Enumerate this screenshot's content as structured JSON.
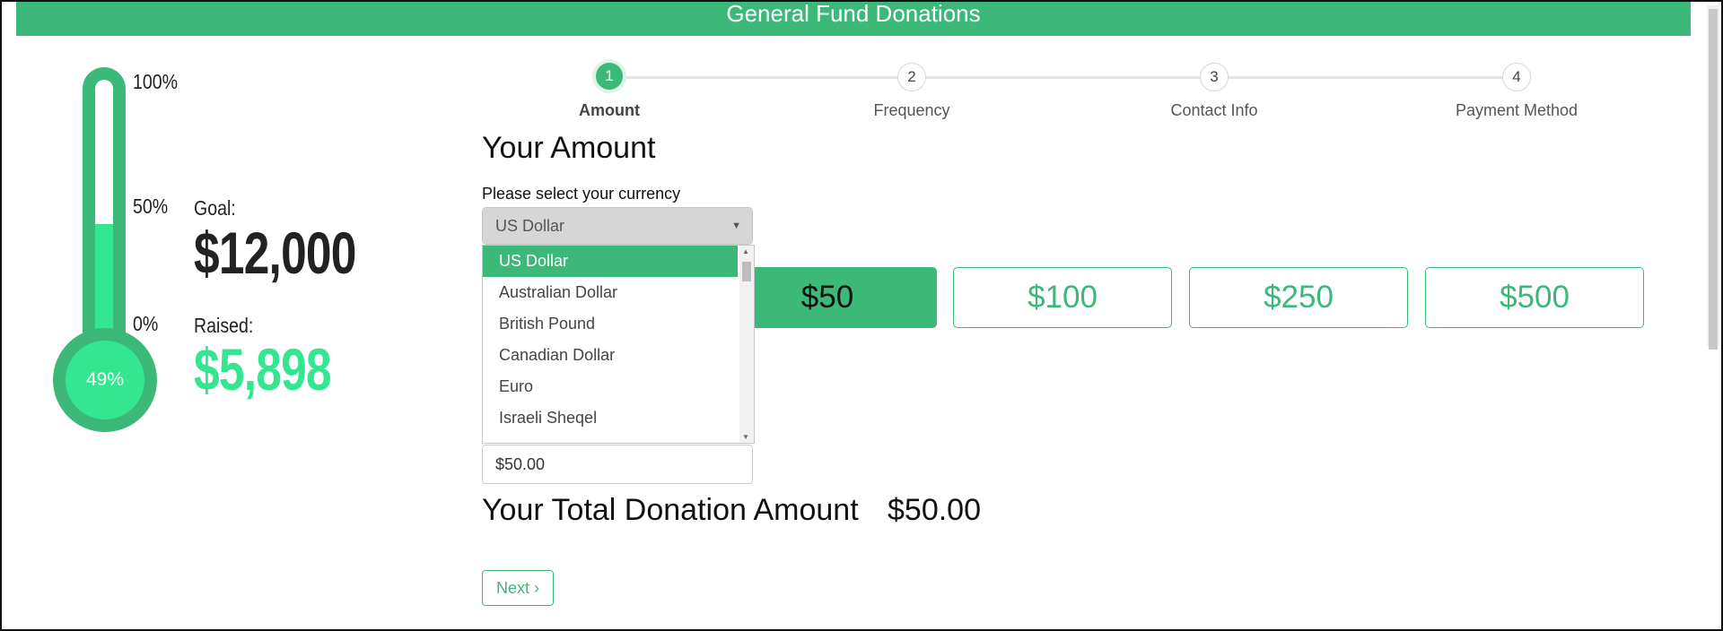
{
  "banner": {
    "title": "General Fund Donations"
  },
  "thermometer": {
    "percent_label": "49%",
    "fill_fraction": 0.49,
    "ticks": {
      "top": "100%",
      "mid": "50%",
      "bottom": "0%"
    },
    "colors": {
      "tube": "#3cb878",
      "fill": "#33e690"
    }
  },
  "stats": {
    "goal_label": "Goal:",
    "goal_value": "$12,000",
    "raised_label": "Raised:",
    "raised_value": "$5,898",
    "raised_color": "#33e690"
  },
  "steps": [
    {
      "number": "1",
      "label": "Amount",
      "active": true
    },
    {
      "number": "2",
      "label": "Frequency",
      "active": false
    },
    {
      "number": "3",
      "label": "Contact Info",
      "active": false
    },
    {
      "number": "4",
      "label": "Payment Method",
      "active": false
    }
  ],
  "form": {
    "title": "Your Amount",
    "currency_label": "Please select your currency",
    "currency_selected": "US Dollar",
    "currency_options": [
      "US Dollar",
      "Australian Dollar",
      "British Pound",
      "Canadian Dollar",
      "Euro",
      "Israeli Sheqel"
    ],
    "amount_buttons": [
      "$50",
      "$100",
      "$250",
      "$500"
    ],
    "selected_amount": "$50",
    "amount_input_value": "$50.00",
    "total_label": "Your Total Donation Amount",
    "total_value": "$50.00",
    "next_label": "Next",
    "next_icon": "chevron-right-icon"
  },
  "accent_color": "#3cb878"
}
